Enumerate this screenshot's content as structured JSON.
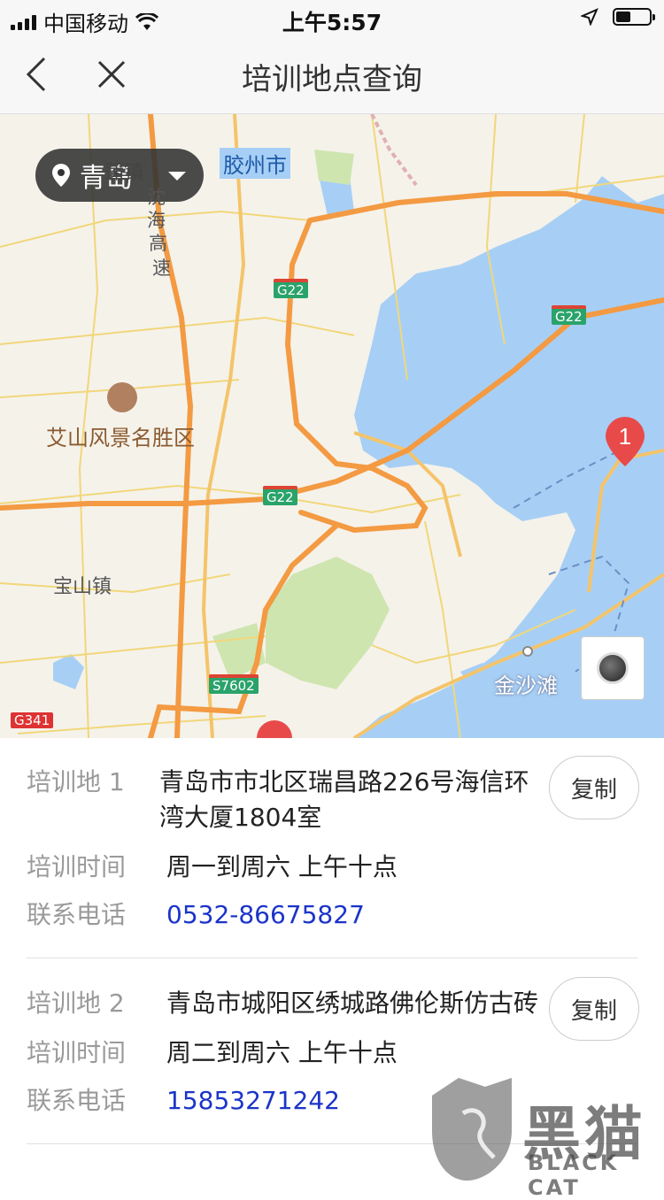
{
  "status_bar": {
    "carrier": "中国移动",
    "time": "上午5:57"
  },
  "nav": {
    "title": "培训地点查询"
  },
  "map": {
    "city": "青岛",
    "labels": {
      "jiaozhou": "胶州市",
      "shenhai_a": "沈",
      "shenhai_b": "海",
      "shenhai_c": "高",
      "shenhai_d": "速",
      "town_top": "蒲镇",
      "aishan": "艾山风景名胜区",
      "baoshan": "宝山镇",
      "jinshatan": "金沙滩"
    },
    "road_badges": {
      "g22_1": "G22",
      "g22_2": "G22",
      "g22_3": "G22",
      "s7602": "S7602",
      "g341": "G341"
    },
    "marker": "1",
    "colors": {
      "water": "#a7cff5",
      "highway": "#f39a42",
      "road": "#f1d77a",
      "green": "#cfe5b0"
    }
  },
  "entries": [
    {
      "location_label": "培训地 1",
      "address_line1": "青岛市市北区瑞昌路226号海信环",
      "address_line2": "湾大厦1804室",
      "time_label": "培训时间",
      "time_value": "周一到周六 上午十点",
      "phone_label": "联系电话",
      "phone_value": "0532-86675827",
      "copy": "复制"
    },
    {
      "location_label": "培训地 2",
      "address_line1": "青岛市城阳区绣城路佛伦斯仿古砖",
      "time_label": "培训时间",
      "time_value": "周二到周六 上午十点",
      "phone_label": "联系电话",
      "phone_value": "15853271242",
      "copy": "复制"
    }
  ],
  "watermark": {
    "cn": "黑猫",
    "en": "BLACK CAT"
  }
}
